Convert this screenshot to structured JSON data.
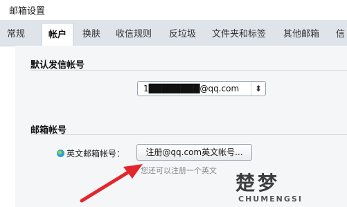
{
  "page": {
    "title": "邮箱设置"
  },
  "tabs": [
    {
      "label": "常规"
    },
    {
      "label": "帐户",
      "active": true
    },
    {
      "label": "换肤"
    },
    {
      "label": "收信规则"
    },
    {
      "label": "反垃圾"
    },
    {
      "label": "文件夹和标签"
    },
    {
      "label": "其他邮箱"
    },
    {
      "label": "信"
    }
  ],
  "sections": {
    "default_sender": {
      "title": "默认发信帐号",
      "select_value": "1████████@qq.com"
    },
    "mailbox_account": {
      "title": "邮箱帐号",
      "field_label": "英文邮箱帐号：",
      "button_label": "注册@qq.com英文帐号...",
      "hint": "您还可以注册一个英文"
    }
  },
  "watermark": {
    "text_cn": "楚梦",
    "text_en": "CHUMENGSI"
  },
  "colors": {
    "arrow": "#e3262b",
    "tabbar": "#dfe4ea",
    "panel": "#f4f6f8"
  }
}
